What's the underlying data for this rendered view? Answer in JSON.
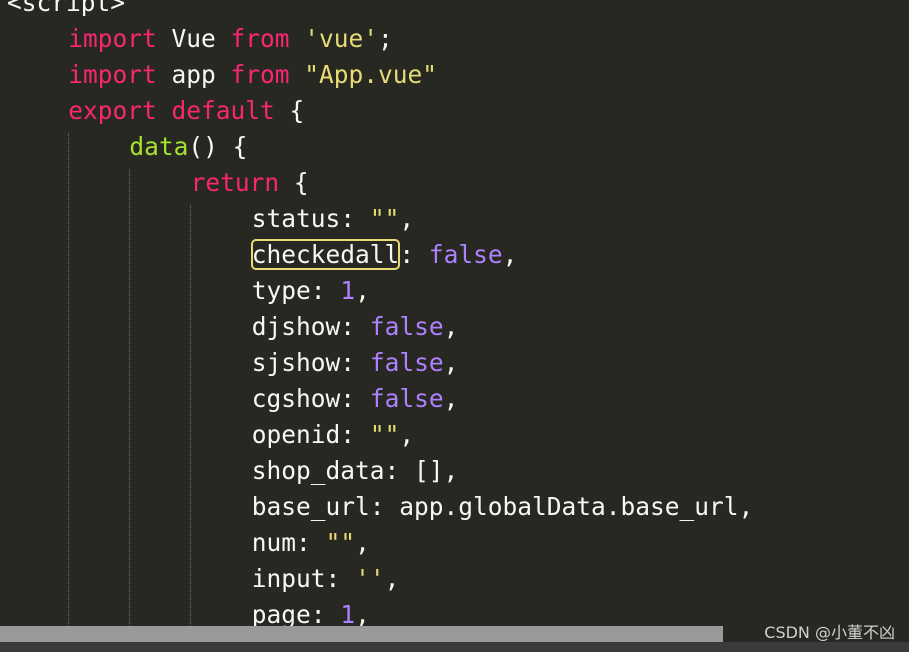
{
  "editor": {
    "lines": [
      {
        "indent": 0,
        "tokens": [
          {
            "t": "<script>",
            "c": "tag"
          }
        ]
      },
      {
        "indent": 1,
        "tokens": [
          {
            "t": "import",
            "c": "kw"
          },
          {
            "t": " Vue ",
            "c": "plain"
          },
          {
            "t": "from",
            "c": "kw"
          },
          {
            "t": " ",
            "c": "plain"
          },
          {
            "t": "'vue'",
            "c": "str"
          },
          {
            "t": ";",
            "c": "plain"
          }
        ]
      },
      {
        "indent": 1,
        "tokens": [
          {
            "t": "import",
            "c": "kw"
          },
          {
            "t": " app ",
            "c": "plain"
          },
          {
            "t": "from",
            "c": "kw"
          },
          {
            "t": " ",
            "c": "plain"
          },
          {
            "t": "\"App.vue\"",
            "c": "str"
          }
        ]
      },
      {
        "indent": 1,
        "tokens": [
          {
            "t": "export",
            "c": "kw"
          },
          {
            "t": " ",
            "c": "plain"
          },
          {
            "t": "default",
            "c": "kw"
          },
          {
            "t": " {",
            "c": "plain"
          }
        ]
      },
      {
        "indent": 2,
        "tokens": [
          {
            "t": "data",
            "c": "fn"
          },
          {
            "t": "() {",
            "c": "plain"
          }
        ]
      },
      {
        "indent": 3,
        "tokens": [
          {
            "t": "return",
            "c": "kw"
          },
          {
            "t": " {",
            "c": "plain"
          }
        ]
      },
      {
        "indent": 4,
        "tokens": [
          {
            "t": "status: ",
            "c": "plain"
          },
          {
            "t": "\"\"",
            "c": "str"
          },
          {
            "t": ",",
            "c": "plain"
          }
        ]
      },
      {
        "indent": 4,
        "tokens": [
          {
            "t": "checkedall",
            "c": "plain",
            "hl": true
          },
          {
            "t": ": ",
            "c": "plain"
          },
          {
            "t": "false",
            "c": "num"
          },
          {
            "t": ",",
            "c": "plain"
          }
        ]
      },
      {
        "indent": 4,
        "tokens": [
          {
            "t": "type: ",
            "c": "plain"
          },
          {
            "t": "1",
            "c": "num"
          },
          {
            "t": ",",
            "c": "plain"
          }
        ]
      },
      {
        "indent": 4,
        "tokens": [
          {
            "t": "djshow: ",
            "c": "plain"
          },
          {
            "t": "false",
            "c": "num"
          },
          {
            "t": ",",
            "c": "plain"
          }
        ]
      },
      {
        "indent": 4,
        "tokens": [
          {
            "t": "sjshow: ",
            "c": "plain"
          },
          {
            "t": "false",
            "c": "num"
          },
          {
            "t": ",",
            "c": "plain"
          }
        ]
      },
      {
        "indent": 4,
        "tokens": [
          {
            "t": "cgshow: ",
            "c": "plain"
          },
          {
            "t": "false",
            "c": "num"
          },
          {
            "t": ",",
            "c": "plain"
          }
        ]
      },
      {
        "indent": 4,
        "tokens": [
          {
            "t": "openid: ",
            "c": "plain"
          },
          {
            "t": "\"\"",
            "c": "str"
          },
          {
            "t": ",",
            "c": "plain"
          }
        ]
      },
      {
        "indent": 4,
        "tokens": [
          {
            "t": "shop_data: [],",
            "c": "plain"
          }
        ]
      },
      {
        "indent": 4,
        "tokens": [
          {
            "t": "base_url: app.globalData.base_url,",
            "c": "plain"
          }
        ]
      },
      {
        "indent": 4,
        "tokens": [
          {
            "t": "num: ",
            "c": "plain"
          },
          {
            "t": "\"\"",
            "c": "str"
          },
          {
            "t": ",",
            "c": "plain"
          }
        ]
      },
      {
        "indent": 4,
        "tokens": [
          {
            "t": "input: ",
            "c": "plain"
          },
          {
            "t": "''",
            "c": "str"
          },
          {
            "t": ",",
            "c": "plain"
          }
        ]
      },
      {
        "indent": 4,
        "tokens": [
          {
            "t": "page: ",
            "c": "plain"
          },
          {
            "t": "1",
            "c": "num"
          },
          {
            "t": ",",
            "c": "plain"
          }
        ]
      }
    ]
  },
  "colors": {
    "background": "#272822",
    "keyword": "#f92672",
    "string": "#e6db74",
    "number": "#ae81ff",
    "function": "#a6e22e",
    "text": "#f8f8f2",
    "highlight_box": "#e6db74"
  },
  "watermark": {
    "text": "CSDN @小董不凶"
  }
}
